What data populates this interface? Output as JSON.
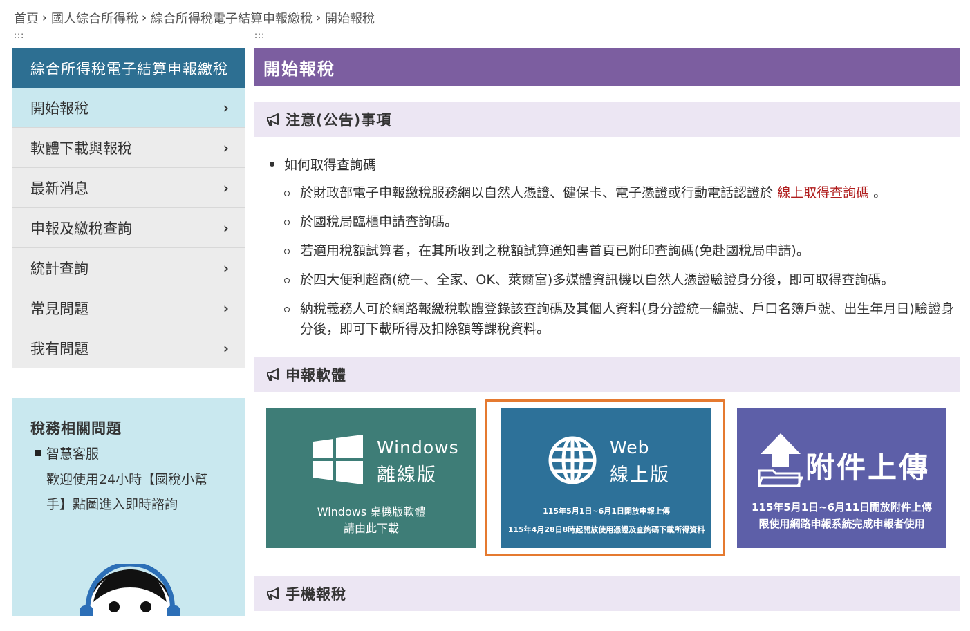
{
  "breadcrumb": {
    "items": [
      "首頁",
      "國人綜合所得稅",
      "綜合所得稅電子結算申報繳稅",
      "開始報稅"
    ],
    "separator": "›"
  },
  "accesskey": {
    "left": ":::",
    "main": ":::"
  },
  "sidebar": {
    "title": "綜合所得稅電子結算申報繳稅",
    "items": [
      {
        "label": "開始報稅"
      },
      {
        "label": "軟體下載與報稅"
      },
      {
        "label": "最新消息"
      },
      {
        "label": "申報及繳稅查詢"
      },
      {
        "label": "統計查詢"
      },
      {
        "label": "常見問題"
      },
      {
        "label": "我有問題"
      }
    ],
    "chevron": "›"
  },
  "related": {
    "title": "稅務相關問題",
    "bullet": "智慧客服",
    "desc": "歡迎使用24小時【國稅小幫手】點圖進入即時諮詢"
  },
  "main": {
    "title": "開始報稅",
    "notice_title": "注意(公告)事項",
    "notice_item": "如何取得查詢碼",
    "notice_subs": {
      "s1_pre": "於財政部電子申報繳稅服務網以自然人憑證、健保卡、電子憑證或行動電話認證於",
      "s1_link": "線上取得查詢碼",
      "s1_post": "。",
      "s2": "於國稅局臨櫃申請查詢碼。",
      "s3": "若適用稅額試算者，在其所收到之稅額試算通知書首頁已附印查詢碼(免赴國稅局申請)。",
      "s4": "於四大便利超商(統一、全家、OK、萊爾富)多媒體資訊機以自然人憑證驗證身分後，即可取得查詢碼。",
      "s5": "納稅義務人可於網路報繳稅軟體登錄該查詢碼及其個人資料(身分證統一編號、戶口名簿戶號、出生年月日)驗證身分後，即可下載所得及扣除額等課稅資料。"
    },
    "software_title": "申報軟體",
    "mobile_title": "手機報稅"
  },
  "tiles": {
    "windows": {
      "t1": "Windows",
      "t2": "離線版",
      "s1": "Windows 桌機版軟體",
      "s2": "請由此下載"
    },
    "web": {
      "t1": "Web",
      "t2": "線上版",
      "s1": "115年5月1日~6月1日開放申報上傳",
      "s2": "115年4月28日8時起開放使用憑證及查詢碼下載所得資料"
    },
    "upload": {
      "t2": "附件上傳",
      "s1": "115年5月1日~6月11日開放附件上傳",
      "s2": "限使用網路申報系統完成申報者使用"
    }
  },
  "colors": {
    "sidebar_header": "#2d6f92",
    "main_header": "#7c5ea0",
    "section_header": "#ece6f3",
    "windows_tile": "#3e7d77",
    "web_tile": "#2d7199",
    "upload_tile": "#5d5fa8",
    "highlight": "#e57a30",
    "link": "#b01d1d"
  },
  "icons": [
    "megaphone-icon",
    "windows-logo-icon",
    "globe-icon",
    "upload-folder-icon",
    "chevron-right-icon"
  ]
}
